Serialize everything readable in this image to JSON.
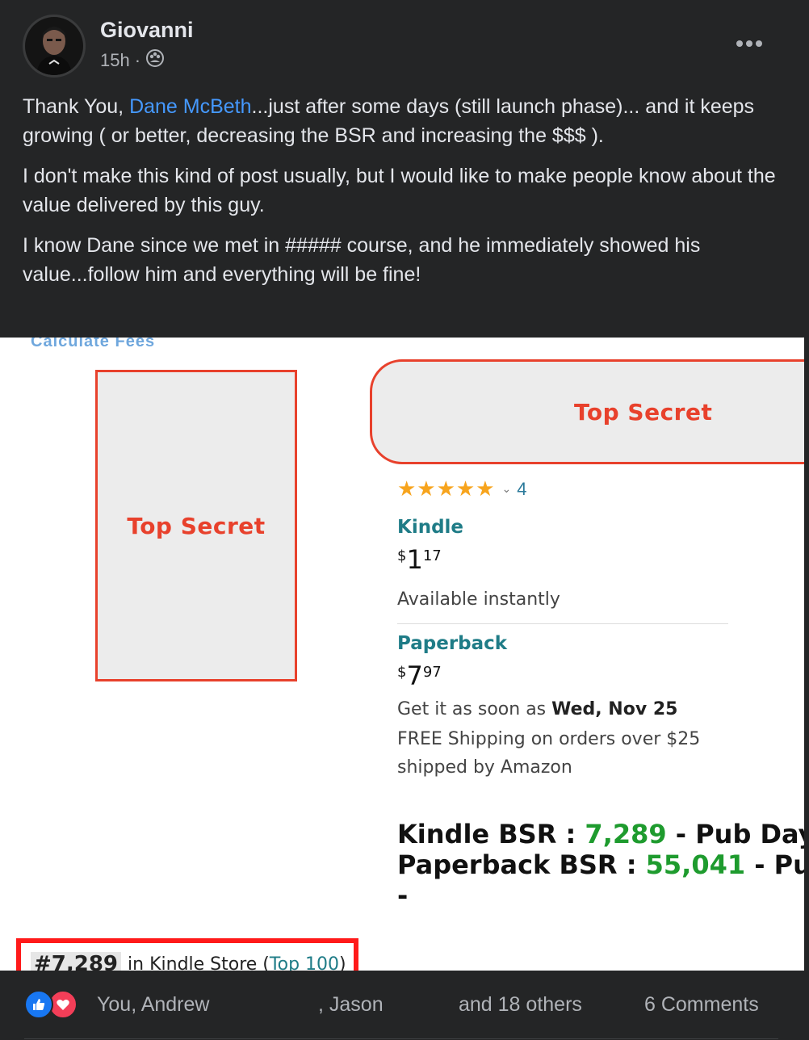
{
  "post": {
    "author": "Giovanni",
    "time": "15h",
    "separator": "·",
    "audience_icon": "group-icon",
    "more_icon": "more-options-icon",
    "paragraphs": {
      "p1_before": "Thank You, ",
      "p1_mention": "Dane McBeth",
      "p1_after": "...just after some days (still launch phase)... and it keeps growing ( or better, decreasing the BSR and increasing the $$$ ).",
      "p2": "I don't make this kind of post usually, but I would like to make people know about the value delivered by this guy.",
      "p3": "I know Dane since we met in ##### course, and he immediately showed his value...follow him and everything will be fine!"
    }
  },
  "screenshot": {
    "cutoff_text": "Calculate Fees",
    "cover_label": "Top Secret",
    "title_label": "Top Secret",
    "stars": "★★★★★",
    "rating_count": "4",
    "kindle": {
      "label": "Kindle",
      "currency": "$",
      "whole": "1",
      "fraction": "17",
      "availability": "Available instantly"
    },
    "paperback": {
      "label": "Paperback",
      "currency": "$",
      "whole": "7",
      "fraction": "97",
      "delivery_prefix": "Get it as soon as ",
      "delivery_date": "Wed, Nov 25",
      "shipping_line1": "FREE Shipping on orders over $25",
      "shipping_line2": "shipped by Amazon"
    },
    "bsr": {
      "kindle_label": "Kindle BSR : ",
      "kindle_value": "7,289",
      "kindle_suffix": " - Pub Days : ",
      "paperback_label": "Paperback BSR : ",
      "paperback_value": "55,041",
      "paperback_suffix": " - Pub Days",
      "dash": "-"
    },
    "rank": {
      "number": "#7,289",
      "store_text": " in Kindle Store (",
      "link": "Top 100",
      "close": ")"
    }
  },
  "footer": {
    "names_1": "You, Andrew",
    "names_2": ", Jason",
    "others": "and 18 others",
    "comments": "6 Comments",
    "reaction_icons": [
      "like-icon",
      "love-icon"
    ]
  },
  "colors": {
    "background": "#242526",
    "mention": "#4599ff",
    "secret_red": "#e8412c",
    "bsr_green": "#1e9b2e",
    "highlight_box": "#ff1a1a"
  }
}
